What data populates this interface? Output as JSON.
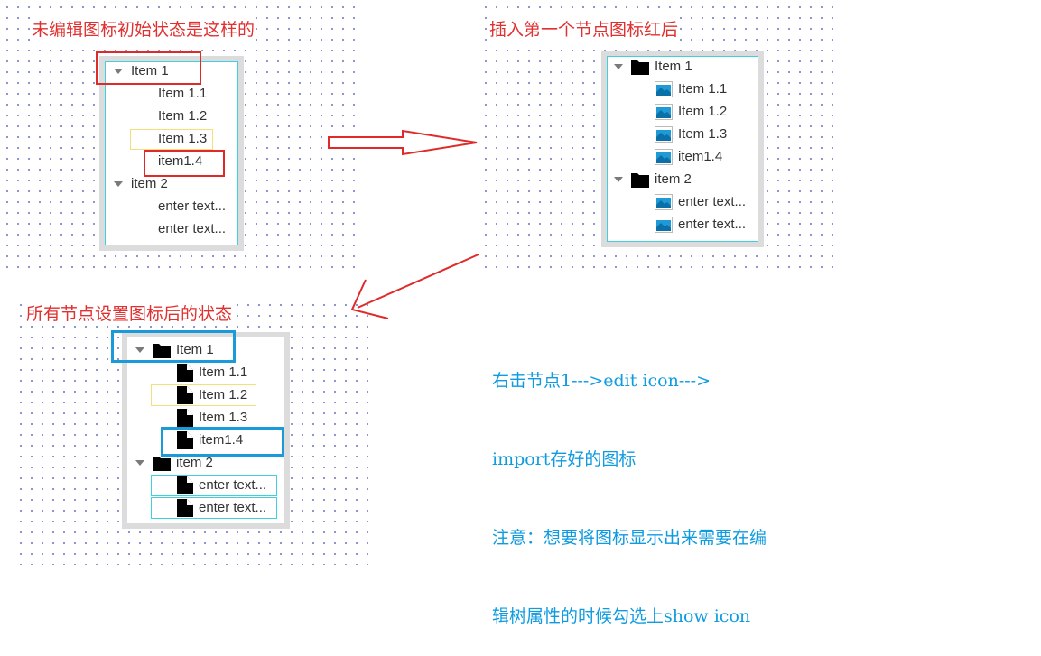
{
  "captions": {
    "initial": "未编辑图标初始状态是这样的",
    "after_first": "插入第一个节点图标红后",
    "after_all": "所有节点设置图标后的状态"
  },
  "tree": {
    "nodes": [
      "Item 1",
      "Item 1.1",
      "Item 1.2",
      "Item 1.3",
      "item1.4",
      "item 2",
      "enter text...",
      "enter text..."
    ]
  },
  "note": {
    "lines": [
      "右击节点1--->edit icon--->",
      "import存好的图标",
      "注意：想要将图标显示出来需要在编",
      "辑树属性的时候勾选上show icon"
    ]
  },
  "colors": {
    "caption": "#e03030",
    "note": "#0f9be0",
    "arrow": "#e02a2a",
    "highlight_red": "#e02a2a",
    "highlight_blue": "#1a9ad8",
    "highlight_yellow": "#f3e07a",
    "tree_border": "#dcdcdc",
    "tree_inner_border": "#3fd0e0",
    "image_icon": "#1e9ad6"
  },
  "icons": {
    "expander": "triangle-down-icon",
    "folder": "folder-icon",
    "image": "image-icon",
    "file": "file-icon"
  }
}
